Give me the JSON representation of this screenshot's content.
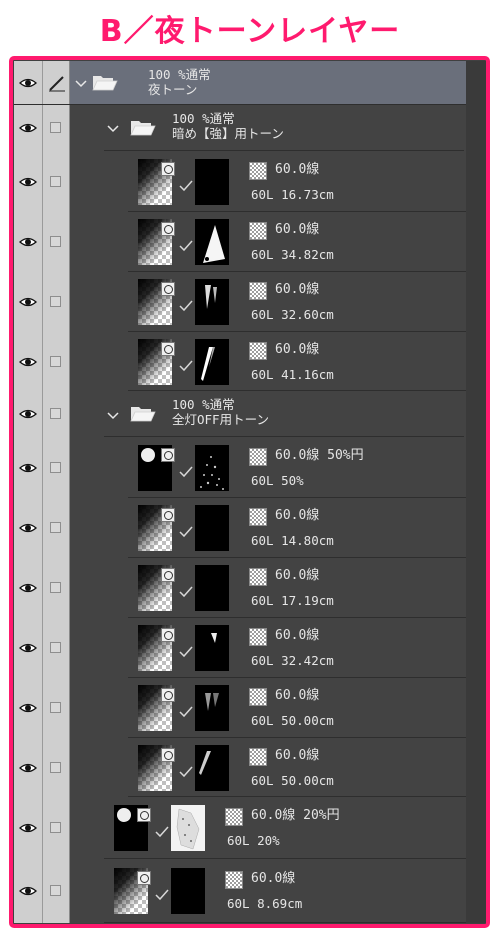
{
  "heading": "B／夜トーンレイヤー",
  "colors": {
    "accent": "#ff1a6e",
    "panel": "#434343",
    "header_row": "#6a6f7b"
  },
  "top_folder": {
    "percent": "100 %通常",
    "name": "夜トーン"
  },
  "group1": {
    "percent": "100 %通常",
    "name": "暗め【強】用トーン"
  },
  "group2": {
    "percent": "100 %通常",
    "name": "全灯OFF用トーン"
  },
  "layers": [
    {
      "tone": "60.0線",
      "info": "60L 16.73cm"
    },
    {
      "tone": "60.0線",
      "info": "60L 34.82cm"
    },
    {
      "tone": "60.0線",
      "info": "60L 32.60cm"
    },
    {
      "tone": "60.0線",
      "info": "60L 41.16cm"
    },
    {
      "tone": "60.0線 50%円",
      "info": "60L 50%"
    },
    {
      "tone": "60.0線",
      "info": "60L 14.80cm"
    },
    {
      "tone": "60.0線",
      "info": "60L 17.19cm"
    },
    {
      "tone": "60.0線",
      "info": "60L 32.42cm"
    },
    {
      "tone": "60.0線",
      "info": "60L 50.00cm"
    },
    {
      "tone": "60.0線",
      "info": "60L 50.00cm"
    },
    {
      "tone": "60.0線 20%円",
      "info": "60L 20%"
    },
    {
      "tone": "60.0線",
      "info": "60L 8.69cm"
    }
  ]
}
